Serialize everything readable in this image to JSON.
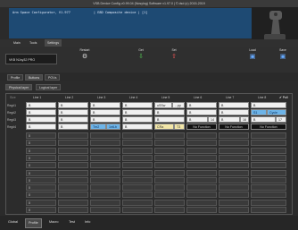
{
  "window": {
    "title": "VSB Device Config v0.99.04 (Nosylog) Software v1.97.0 | © dsd (c) 2015-2019"
  },
  "console": {
    "line1": "Arm Space Configurator, V1.977            | E8D Composite device | [1]"
  },
  "menu": {
    "items": [
      "Main",
      "Tools",
      "Settings"
    ]
  },
  "device": {
    "selected": "VKB NJoy32 PRO"
  },
  "toolbar": {
    "restart": "Restart",
    "get": "Get",
    "set": "Set",
    "load": "Load",
    "save": "Save"
  },
  "tabs1": [
    "Profile",
    "Buttons",
    "POVs"
  ],
  "tabs2": [
    "Physical layer",
    "Logical layer"
  ],
  "grid": {
    "line_headers": [
      "Line 1",
      "Line 2",
      "Line 3",
      "Line 4",
      "Line 5",
      "Line 6",
      "Line 7",
      "Line 8"
    ],
    "poll_label": "Poll",
    "row_labels": [
      "Reg#1",
      "Reg#2",
      "Reg#3",
      "Reg#4"
    ],
    "rows": [
      [
        "B",
        "B",
        "B",
        "B",
        "uSSw",
        "B",
        "B",
        "B"
      ],
      [
        "B",
        "B",
        "B",
        "B",
        "B",
        "B",
        "B",
        "S1"
      ],
      [
        "B",
        "B",
        "B",
        "B",
        "B",
        "B",
        "B",
        "B"
      ],
      [
        "B",
        "B",
        "Tm2",
        "B",
        "CRa",
        "No Function",
        "No Function",
        "No Function"
      ]
    ],
    "extra_cells": {
      "r1c5_right": "...py",
      "r2c8_right": "Cycle",
      "r3c6_num": "14",
      "r3c7_num": "16",
      "r3c8_num": "17",
      "r4c3_right": "1ntLb",
      "r4c5_right": "T3"
    },
    "empty_label": "0"
  },
  "bottom_tabs": [
    "Global",
    "Profile",
    "Macro",
    "Test",
    "Info"
  ]
}
